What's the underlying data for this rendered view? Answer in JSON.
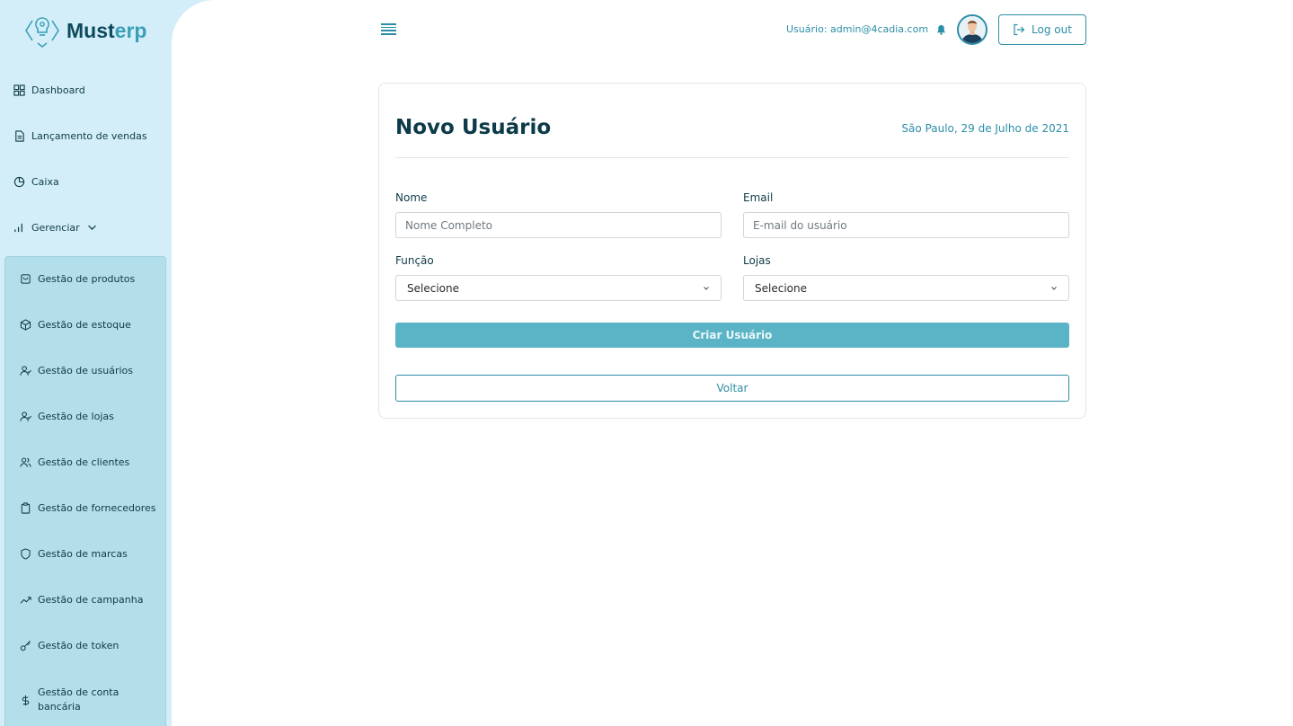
{
  "app": {
    "name_main": "Must",
    "name_accent": "erp",
    "logo_icon": "lightbulb-gear-icon"
  },
  "sidebar": {
    "items": [
      {
        "label": "Dashboard",
        "icon": "grid-icon"
      },
      {
        "label": "Lançamento de vendas",
        "icon": "document-icon"
      },
      {
        "label": "Caixa",
        "icon": "pie-chart-icon"
      },
      {
        "label": "Gerenciar",
        "icon": "bar-chart-icon",
        "expanded": true
      }
    ],
    "submenu": [
      {
        "label": "Gestão de produtos",
        "icon": "shopping-bag-icon"
      },
      {
        "label": "Gestão de estoque",
        "icon": "box-icon"
      },
      {
        "label": "Gestão de usuários",
        "icon": "user-check-icon"
      },
      {
        "label": "Gestão de lojas",
        "icon": "user-check-icon"
      },
      {
        "label": "Gestão de clientes",
        "icon": "users-icon"
      },
      {
        "label": "Gestão de fornecedores",
        "icon": "clipboard-icon"
      },
      {
        "label": "Gestão de marcas",
        "icon": "shield-icon"
      },
      {
        "label": "Gestão de campanha",
        "icon": "trending-up-icon"
      },
      {
        "label": "Gestão de token",
        "icon": "key-icon"
      },
      {
        "label": "Gestão de conta bancária",
        "icon": "dollar-icon"
      }
    ]
  },
  "header": {
    "user_label": "Usuário: admin@4cadia.com",
    "logout_label": "Log out"
  },
  "form": {
    "title": "Novo Usuário",
    "date": "São Paulo, 29 de Julho de 2021",
    "nome": {
      "label": "Nome",
      "placeholder": "Nome Completo",
      "value": ""
    },
    "email": {
      "label": "Email",
      "placeholder": "E-mail do usuário",
      "value": ""
    },
    "funcao": {
      "label": "Função",
      "selected": "Selecione"
    },
    "lojas": {
      "label": "Lojas",
      "selected": "Selecione"
    },
    "submit_label": "Criar Usuário",
    "back_label": "Voltar"
  },
  "colors": {
    "sidebar_bg": "#d3eef9",
    "submenu_bg": "#b3dfeb",
    "accent": "#2c8ea6",
    "primary_button": "#5ab4c5",
    "title": "#0c3a48"
  }
}
